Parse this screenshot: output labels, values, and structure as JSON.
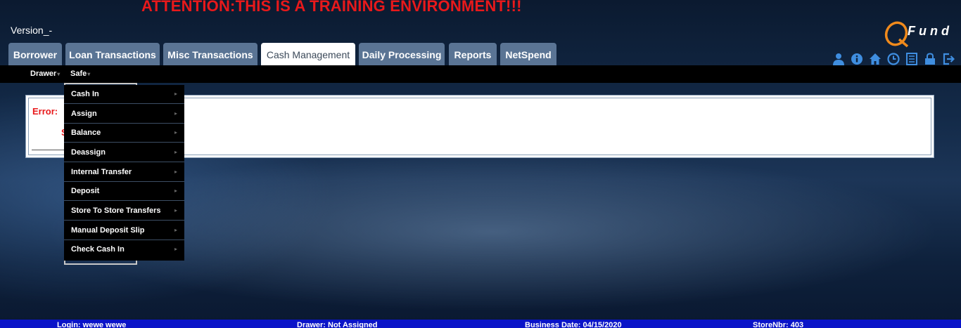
{
  "banner": "ATTENTION:THIS IS A TRAINING ENVIRONMENT!!!",
  "version": "Version_-",
  "logo": {
    "text": "Fund",
    "icon": "qfund-logo-icon"
  },
  "tabs": [
    {
      "label": "Borrower",
      "active": false
    },
    {
      "label": "Loan Transactions",
      "active": false
    },
    {
      "label": "Misc Transactions",
      "active": false
    },
    {
      "label": "Cash Management",
      "active": true
    },
    {
      "label": "Daily Processing",
      "active": false
    },
    {
      "label": "Reports",
      "active": false
    },
    {
      "label": "NetSpend",
      "active": false
    }
  ],
  "toolbar_icons": [
    "user-icon",
    "info-icon",
    "home-icon",
    "clock-icon",
    "notes-icon",
    "lock-icon",
    "logout-icon"
  ],
  "menubar": {
    "drawer": "Drawer",
    "safe": "Safe"
  },
  "safe_menu": [
    "Cash In",
    "Assign",
    "Balance",
    "Deassign",
    "Internal Transfer",
    "Deposit",
    "Store To Store Transfers",
    "Manual Deposit Slip",
    "Check Cash In"
  ],
  "error": {
    "label": "Error:",
    "message_fragment": "S"
  },
  "status": {
    "login": "Login: wewe wewe",
    "drawer": "Drawer: Not Assigned",
    "business_date": "Business Date: 04/15/2020",
    "store": "StoreNbr: 403"
  },
  "colors": {
    "accent_red": "#e8191b",
    "tab_bg": "#5a7494",
    "status_bg": "#0a14c8",
    "icon_blue": "#3f8ee0",
    "logo_orange": "#f08a1c"
  }
}
